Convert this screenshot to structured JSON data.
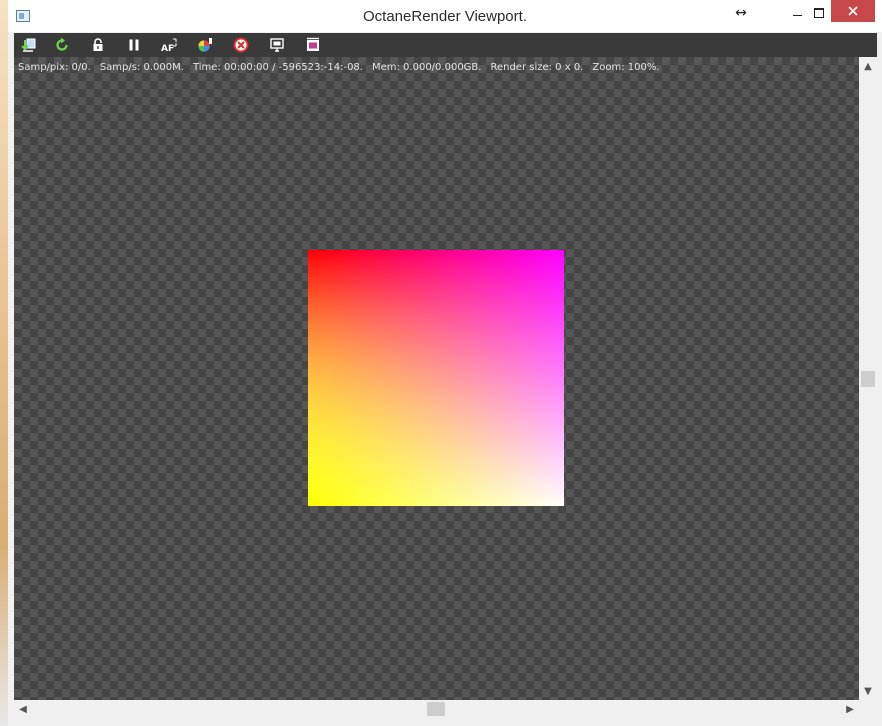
{
  "window": {
    "title": "OctaneRender Viewport.",
    "resize_glyph": "↔"
  },
  "toolbar": {
    "tools": [
      {
        "name": "send-to-octane-icon"
      },
      {
        "name": "restart-render-icon"
      },
      {
        "name": "lock-icon"
      },
      {
        "name": "pause-icon"
      },
      {
        "name": "autofocus-icon",
        "label": "AF"
      },
      {
        "name": "color-picker-icon"
      },
      {
        "name": "clear-render-icon"
      },
      {
        "name": "region-render-icon"
      },
      {
        "name": "film-settings-icon"
      }
    ]
  },
  "status": {
    "samples_per_pixel": "Samp/pix: 0/0.",
    "samples_per_second": "Samp/s: 0.000M.",
    "time": "Time: 00:00:00 / -596523:-14:-08.",
    "memory": "Mem: 0.000/0.000GB.",
    "render_size": "Render size: 0 x 0.",
    "zoom": "Zoom: 100%."
  },
  "scrollbars": {
    "up": "▲",
    "down": "▼",
    "left": "◀",
    "right": "▶"
  },
  "colors": {
    "toolbar_bg": "#3a3a3a",
    "close_button": "#c7474a",
    "render_top_left": "#ff0000",
    "render_top_right": "#ff00ff",
    "render_bottom_left": "#ffff00",
    "render_bottom_right": "#ffffff"
  }
}
